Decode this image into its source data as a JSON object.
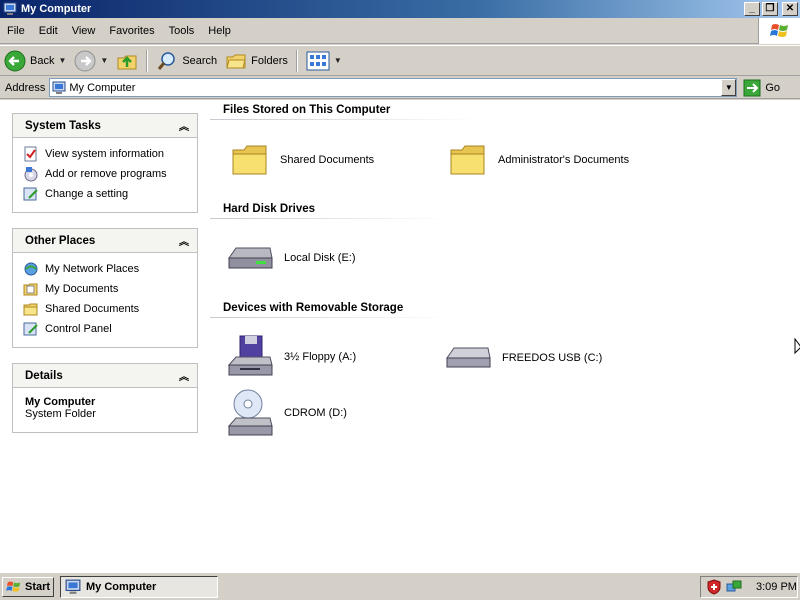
{
  "window": {
    "title": "My Computer",
    "minimize": "_",
    "maximize": "❐",
    "close": "✕"
  },
  "menu": [
    "File",
    "Edit",
    "View",
    "Favorites",
    "Tools",
    "Help"
  ],
  "toolbar": {
    "back": "Back",
    "search": "Search",
    "folders": "Folders"
  },
  "address": {
    "label": "Address",
    "value": "My Computer",
    "go": "Go"
  },
  "tasks": {
    "system": {
      "title": "System Tasks",
      "items": [
        "View system information",
        "Add or remove programs",
        "Change a setting"
      ]
    },
    "other": {
      "title": "Other Places",
      "items": [
        "My Network Places",
        "My Documents",
        "Shared Documents",
        "Control Panel"
      ]
    },
    "details": {
      "title": "Details",
      "name": "My Computer",
      "type": "System Folder"
    }
  },
  "groups": [
    {
      "title": "Files Stored on This Computer",
      "items": [
        "Shared Documents",
        "Administrator's Documents"
      ]
    },
    {
      "title": "Hard Disk Drives",
      "items": [
        "Local Disk (E:)"
      ]
    },
    {
      "title": "Devices with Removable Storage",
      "items": [
        "3½ Floppy (A:)",
        "FREEDOS USB (C:)",
        "CDROM (D:)"
      ]
    }
  ],
  "taskbar": {
    "start": "Start",
    "task": "My Computer",
    "time": "3:09 PM"
  }
}
